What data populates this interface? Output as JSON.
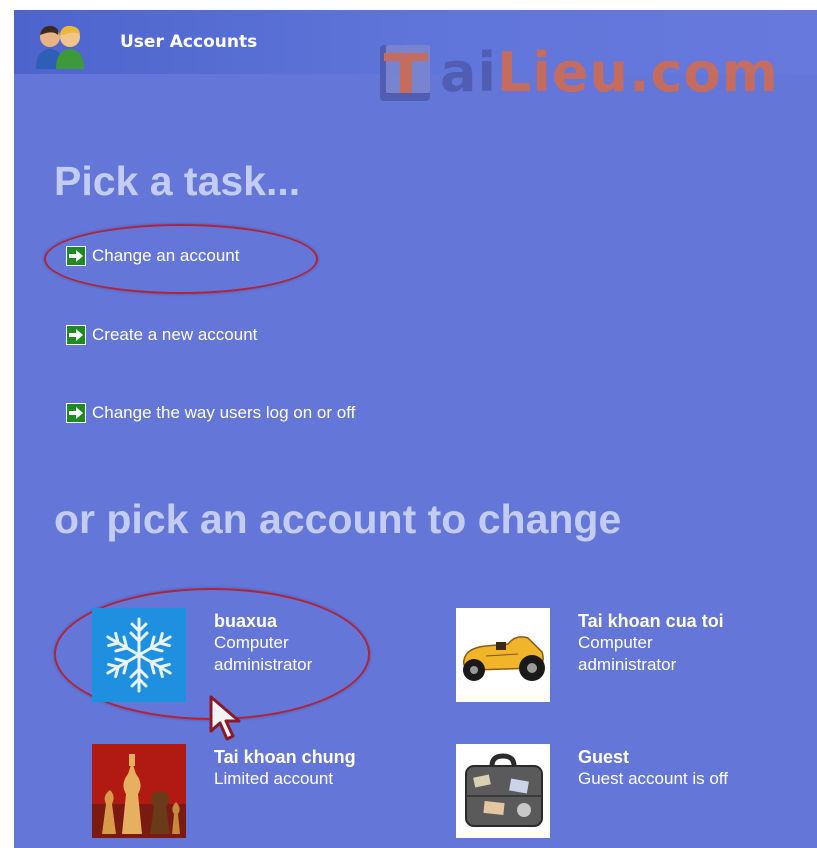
{
  "header": {
    "title": "User Accounts",
    "icon": "user-accounts-icon",
    "watermark": {
      "part1": "T",
      "part2": "ai",
      "part3": "Lieu",
      "part4": ".com"
    }
  },
  "tasks_section": {
    "heading": "Pick a task...",
    "items": [
      {
        "label": "Change an account",
        "icon": "green-arrow-icon"
      },
      {
        "label": "Create a new account",
        "icon": "green-arrow-icon"
      },
      {
        "label": "Change the way users log on or off",
        "icon": "green-arrow-icon"
      }
    ]
  },
  "accounts_section": {
    "heading": "or pick an account to change",
    "accounts": [
      {
        "name": "buaxua",
        "line1": "Computer",
        "line2": "administrator",
        "picture": "snowflake"
      },
      {
        "name": "Tai khoan cua toi",
        "line1": "Computer",
        "line2": "administrator",
        "picture": "race-car"
      },
      {
        "name": "Tai khoan chung",
        "line1": "Limited account",
        "line2": "",
        "picture": "chess-pieces"
      },
      {
        "name": "Guest",
        "line1": "Guest account is off",
        "line2": "",
        "picture": "suitcase"
      }
    ]
  },
  "colors": {
    "panel_bg": "#6576d9",
    "heading": "#c3ccf3",
    "highlight_circle": "#b0243a",
    "arrow_green": "#1f8a1f"
  }
}
